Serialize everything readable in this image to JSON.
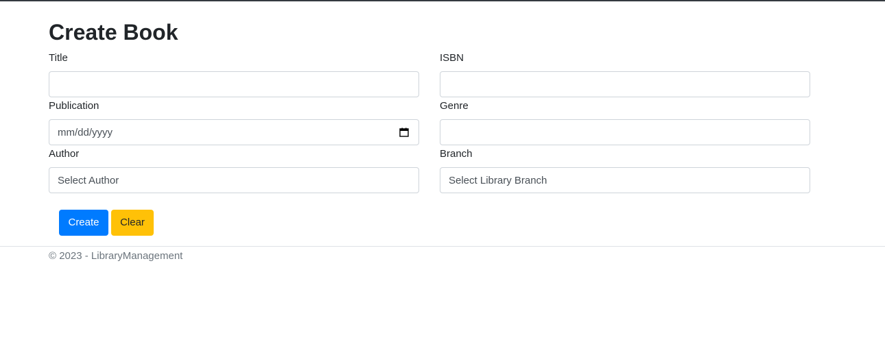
{
  "page": {
    "title": "Create Book"
  },
  "form": {
    "title_label": "Title",
    "title_value": "",
    "isbn_label": "ISBN",
    "isbn_value": "",
    "publication_label": "Publication",
    "publication_placeholder": "mm/dd/yyyy",
    "genre_label": "Genre",
    "genre_value": "",
    "author_label": "Author",
    "author_selected": "Select Author",
    "branch_label": "Branch",
    "branch_selected": "Select Library Branch"
  },
  "buttons": {
    "create_label": "Create",
    "clear_label": "Clear"
  },
  "footer": {
    "text": "© 2023 - LibraryManagement"
  },
  "icons": {
    "date": "calendar-icon"
  },
  "colors": {
    "primary": "#007bff",
    "warning": "#ffc107",
    "text": "#212529",
    "muted": "#6c757d",
    "border": "#ced4da"
  }
}
